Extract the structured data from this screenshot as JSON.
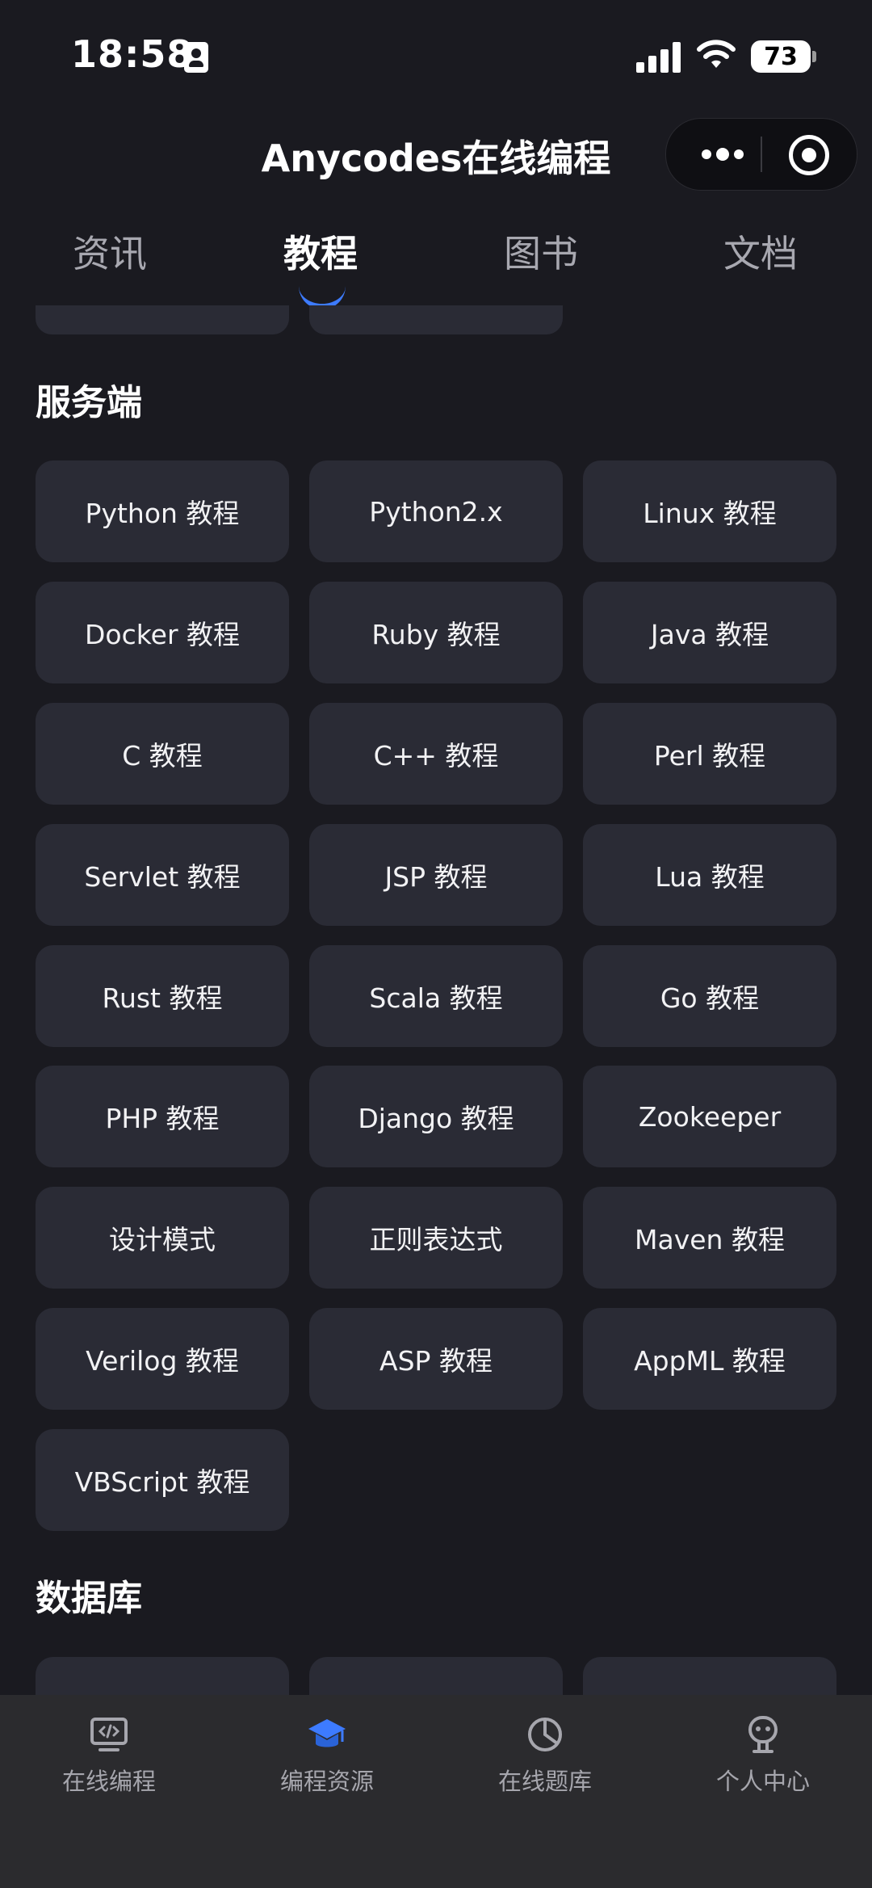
{
  "status_bar": {
    "time": "18:58",
    "battery": "73"
  },
  "header": {
    "title": "Anycodes在线编程"
  },
  "tabs": [
    {
      "label": "资讯",
      "active": false
    },
    {
      "label": "教程",
      "active": true
    },
    {
      "label": "图书",
      "active": false
    },
    {
      "label": "文档",
      "active": false
    }
  ],
  "sections": [
    {
      "title": "服务端",
      "items": [
        "Python 教程",
        "Python2.x",
        "Linux 教程",
        "Docker 教程",
        "Ruby 教程",
        "Java 教程",
        "C 教程",
        "C++ 教程",
        "Perl 教程",
        "Servlet 教程",
        "JSP 教程",
        "Lua 教程",
        "Rust 教程",
        "Scala 教程",
        "Go 教程",
        "PHP 教程",
        "Django 教程",
        "Zookeeper",
        "设计模式",
        "正则表达式",
        "Maven 教程",
        "Verilog 教程",
        "ASP 教程",
        "AppML 教程",
        "VBScript 教程"
      ]
    },
    {
      "title": "数据库"
    }
  ],
  "bottom_nav": [
    {
      "label": "在线编程",
      "icon": "monitor-code-icon"
    },
    {
      "label": "编程资源",
      "icon": "graduation-cap-icon",
      "active": true
    },
    {
      "label": "在线题库",
      "icon": "pie-chart-icon"
    },
    {
      "label": "个人中心",
      "icon": "robot-face-icon"
    }
  ],
  "colors": {
    "accent": "#3d7bff",
    "background": "#1a1a20",
    "card": "#2a2b35",
    "tabbar": "#2b2b2e"
  }
}
